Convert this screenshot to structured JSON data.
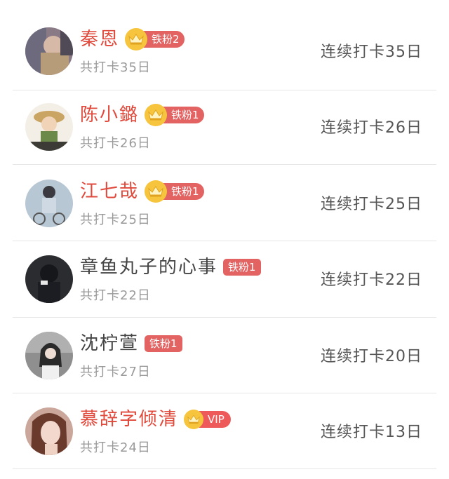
{
  "colors": {
    "name_red": "#e04a3c",
    "name_gray": "#444444",
    "badge_red": "#e36262",
    "crown_gold": "#f6c53d",
    "sub_text": "#9a9a9a",
    "divider": "#e6e6e6"
  },
  "rows": [
    {
      "name": "秦恩",
      "name_style": "red",
      "badge": "铁粉2",
      "crown_icon": "crown-icon",
      "total": "共打卡35日",
      "streak": "连续打卡35日"
    },
    {
      "name": "陈小鏴",
      "name_style": "red",
      "badge": "铁粉1",
      "crown_icon": "crown-icon",
      "total": "共打卡26日",
      "streak": "连续打卡26日"
    },
    {
      "name": "江七哉",
      "name_style": "red",
      "badge": "铁粉1",
      "crown_icon": "crown-icon",
      "total": "共打卡25日",
      "streak": "连续打卡25日"
    },
    {
      "name": "章鱼丸子的心事",
      "name_style": "gray",
      "badge": "铁粉1",
      "crown_icon": "",
      "total": "共打卡22日",
      "streak": "连续打卡22日"
    },
    {
      "name": "沈柠萱",
      "name_style": "gray",
      "badge": "铁粉1",
      "crown_icon": "",
      "total": "共打卡27日",
      "streak": "连续打卡20日"
    },
    {
      "name": "慕辞字倾清",
      "name_style": "red",
      "badge": "VIP",
      "crown_icon": "crown-icon",
      "total": "共打卡24日",
      "streak": "连续打卡13日"
    }
  ]
}
